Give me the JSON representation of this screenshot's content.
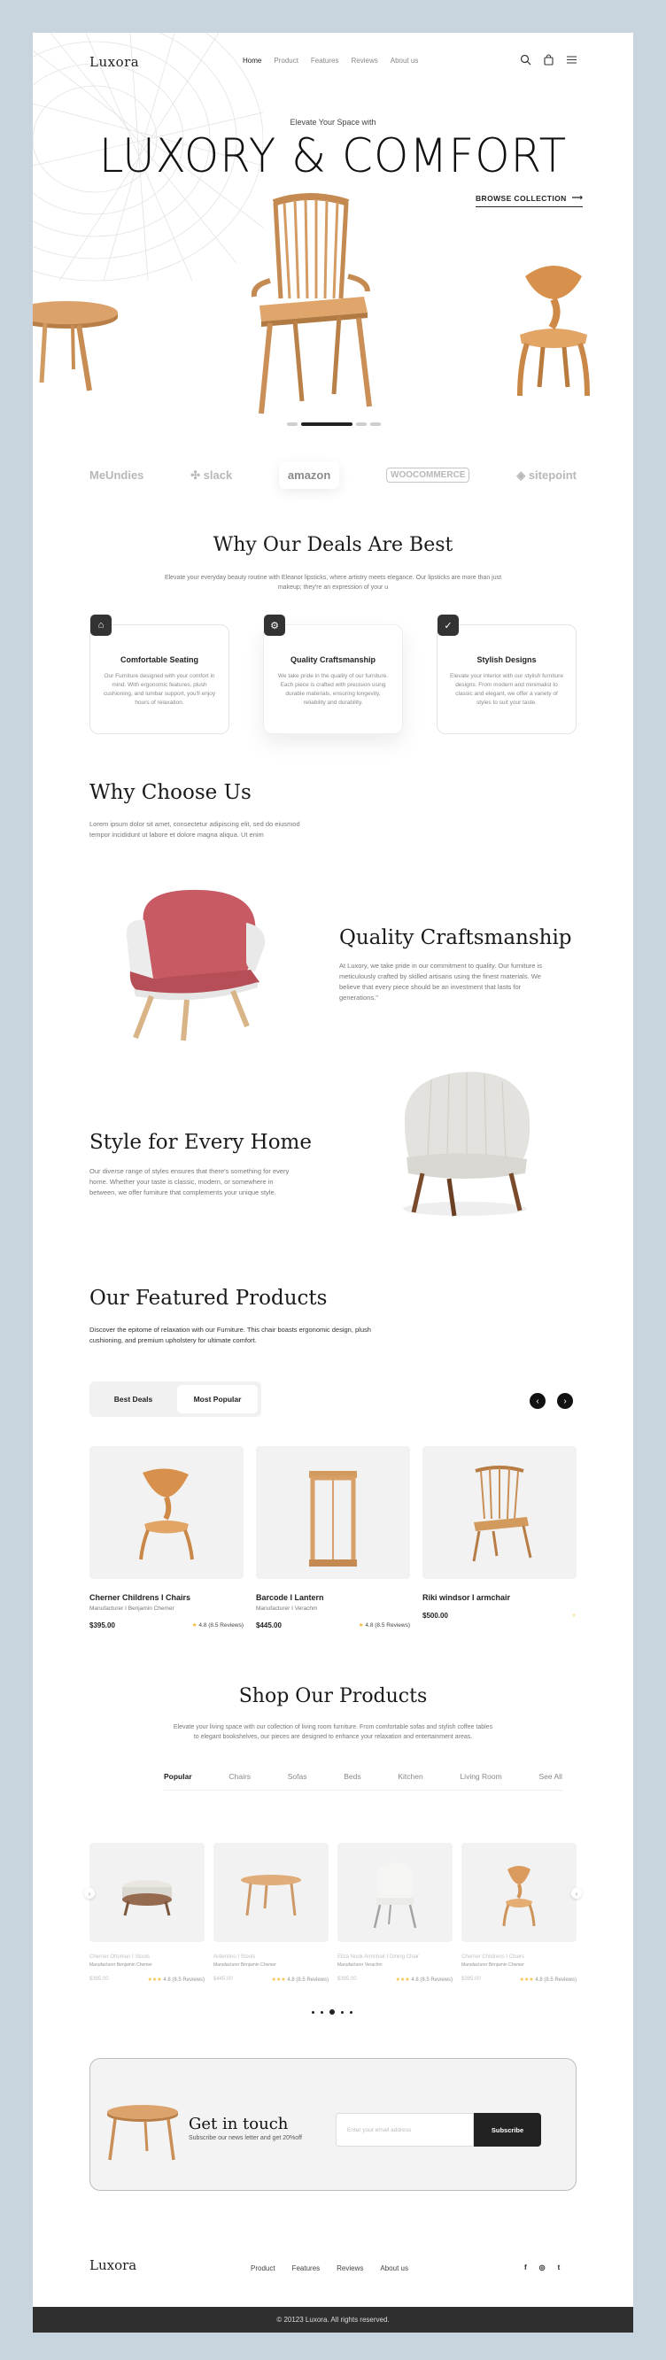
{
  "brand": "Luxora",
  "nav": {
    "links": [
      "Home",
      "Product",
      "Features",
      "Reviews",
      "About us"
    ]
  },
  "nav_icons": [
    "search-icon",
    "bag-icon",
    "menu-icon"
  ],
  "hero": {
    "subtitle": "Elevate Your Space with",
    "title": "LUXORY & COMFORT",
    "cta": "BROWSE COLLECTION"
  },
  "partners": [
    "MeUndies",
    "slack",
    "amazon",
    "WOOCOMMERCE",
    "sitepoint"
  ],
  "deals": {
    "title": "Why Our Deals Are Best",
    "intro": "Elevate your everyday beauty routine with Eleanor lipsticks, where artistry meets elegance. Our lipsticks are more than just makeup; they're an expression of your u",
    "cards": [
      {
        "title": "Comfortable Seating",
        "text": "Our Furniture designed with your comfort in mind. With ergonomic features, plush cushioning, and lumbar support, you'll enjoy hours of relaxation."
      },
      {
        "title": "Quality Craftsmanship",
        "text": "We take pride in the quality of our furniture. Each piece is crafted with precision using durable materials, ensuring longevity, reliability and durability."
      },
      {
        "title": "Stylish Designs",
        "text": "Elevate your interior with our stylish furniture designs. From modern and minimalist to classic and elegant, we offer a variety of styles to suit your taste."
      }
    ]
  },
  "choose": {
    "title": "Why Choose Us",
    "text": "Lorem ipsum dolor sit amet, consectetur adipiscing elit, sed do eiusmod tempor incididunt ut labore et dolore magna aliqua. Ut enim"
  },
  "craft": {
    "title": "Quality Craftsmanship",
    "text": "At Luxory, we take pride in our commitment to quality. Our furniture is meticulously crafted by skilled artisans using the finest materials. We believe that every piece should be an investment that lasts for generations.\""
  },
  "style": {
    "title": "Style for Every Home",
    "text": "Our diverse range of styles ensures that there's something for every home. Whether your taste is classic, modern, or somewhere in between, we offer furniture that complements your unique style."
  },
  "featured": {
    "title": "Our Featured Products",
    "text": "Discover the epitome of relaxation with our Furniture. This chair boasts ergonomic design, plush cushioning, and premium upholstery for ultimate comfort.",
    "tabs": [
      "Best Deals",
      "Most Popular"
    ],
    "products": [
      {
        "name": "Cherner Childrens I Chairs",
        "maker": "Manufacturer I Benjamin Chemer",
        "price": "$395.00",
        "rating": "4.8 (8.5 Reviews)"
      },
      {
        "name": "Barcode I Lantern",
        "maker": "Manufacturer I Verachm",
        "price": "$445.00",
        "rating": "4.8 (8.5 Reviews)"
      },
      {
        "name": "Riki windsor I armchair",
        "maker": "",
        "price": "$500.00",
        "rating": ""
      }
    ]
  },
  "shop": {
    "title": "Shop Our Products",
    "text": "Elevate your living space with our collection of living room furniture. From comfortable sofas and stylish coffee tables to elegant bookshelves, our pieces are designed to enhance your relaxation and entertainment areas.",
    "filters": [
      "Popular",
      "Chairs",
      "Sofas",
      "Beds",
      "Kitchen",
      "Living Room",
      "See All"
    ],
    "items": [
      {
        "name": "Cherner Ottoman I Stools",
        "maker": "Manufacturer Benjamin Chemer",
        "price": "$395.00",
        "rating": "4.8 (8.5 Reviews)"
      },
      {
        "name": "Ardentino I Stools",
        "maker": "Manufacturer Benjamin Chemer",
        "price": "$445.00",
        "rating": "4.8 (8.5 Reviews)"
      },
      {
        "name": "Eliza Nook Armchair I Dining Chair",
        "maker": "Manufacturer Verachm",
        "price": "$395.00",
        "rating": "4.8 (8.5 Reviews)"
      },
      {
        "name": "Cherner Childrens I Chairs",
        "maker": "Manufacturer Benjamin Chemer",
        "price": "$395.00",
        "rating": "4.8 (8.5 Reviews)"
      }
    ]
  },
  "contact": {
    "title": "Get in touch",
    "subtitle": "Subscribe our news letter and get 20%off",
    "placeholder": "Enter your email address",
    "button": "Subscribe"
  },
  "footer": {
    "links": [
      "Product",
      "Features",
      "Reviews",
      "About us"
    ],
    "social": [
      "f",
      "◎",
      "t"
    ],
    "copyright": "© 20123 Luxora. All rights reserved."
  },
  "colors": {
    "accent": "#222222",
    "chair_wood": "#d8a067",
    "rose": "#c85a63",
    "background": "#c9d5de"
  }
}
